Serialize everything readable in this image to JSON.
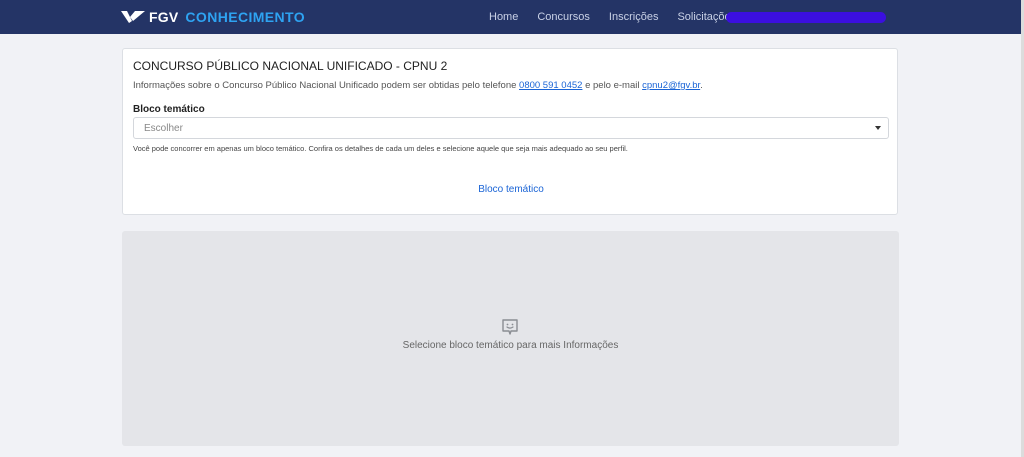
{
  "header": {
    "brand_primary": "FGV",
    "brand_secondary": "CONHECIMENTO",
    "nav": [
      {
        "label": "Home"
      },
      {
        "label": "Concursos"
      },
      {
        "label": "Inscrições"
      },
      {
        "label": "Solicitações"
      }
    ],
    "colors": {
      "background": "#243466",
      "brand_accent": "#2ea3f2",
      "user_pill": "#3b0fe0"
    }
  },
  "card": {
    "title": "CONCURSO PÚBLICO NACIONAL UNIFICADO - CPNU 2",
    "info_prefix": "Informações sobre o Concurso Público Nacional Unificado podem ser obtidas pelo telefone",
    "phone": "0800 591 0452",
    "info_middle": "e pelo e-mail",
    "email": "cpnu2@fgv.br",
    "info_suffix": ".",
    "field_label": "Bloco temático",
    "select_placeholder": "Escolher",
    "help_text": "Você pode concorrer em apenas um bloco temático. Confira os detalhes de cada um deles e selecione aquele que seja mais adequado ao seu perfil.",
    "link_label": "Bloco temático"
  },
  "info_panel": {
    "icon": "message-smile-icon",
    "text": "Selecione bloco temático para mais Informações"
  }
}
